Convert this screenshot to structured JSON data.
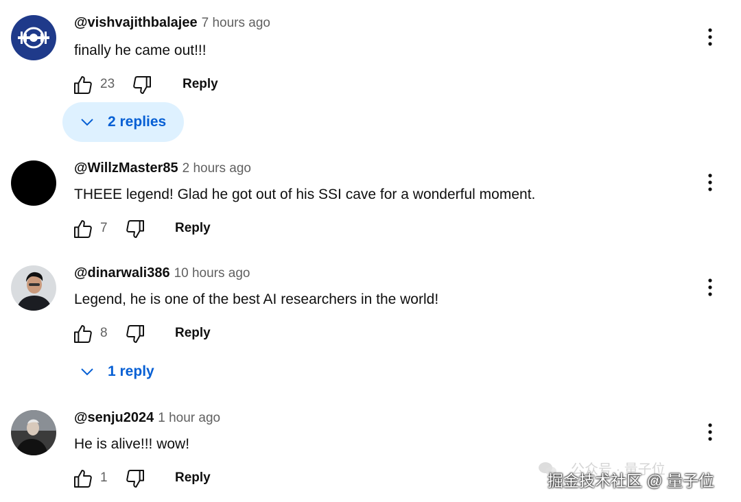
{
  "comments": [
    {
      "handle": "@vishvajithbalajee",
      "time": "7 hours ago",
      "text": "finally he came out!!!",
      "likes": "23",
      "reply_label": "Reply",
      "replies_label": "2 replies",
      "avatar": "astronaut-logo-icon"
    },
    {
      "handle": "@WillzMaster85",
      "time": "2 hours ago",
      "text": "THEEE legend! Glad he got out of his SSI cave for a wonderful moment.",
      "likes": "7",
      "reply_label": "Reply",
      "avatar": "black-circle"
    },
    {
      "handle": "@dinarwali386",
      "time": "10 hours ago",
      "text": "Legend, he is one of the best AI researchers in the world!",
      "likes": "8",
      "reply_label": "Reply",
      "replies_label": "1 reply",
      "avatar": "person-photo"
    },
    {
      "handle": "@senju2024",
      "time": "1 hour ago",
      "text": "He is alive!!! wow!",
      "likes": "1",
      "reply_label": "Reply",
      "avatar": "person-photo"
    }
  ],
  "watermark": {
    "top": "公众号 · 量子位",
    "bottom": "掘金技术社区 @ 量子位"
  },
  "colors": {
    "link_blue": "#065fd4",
    "pill_bg": "#def1ff",
    "meta_gray": "#606060"
  }
}
